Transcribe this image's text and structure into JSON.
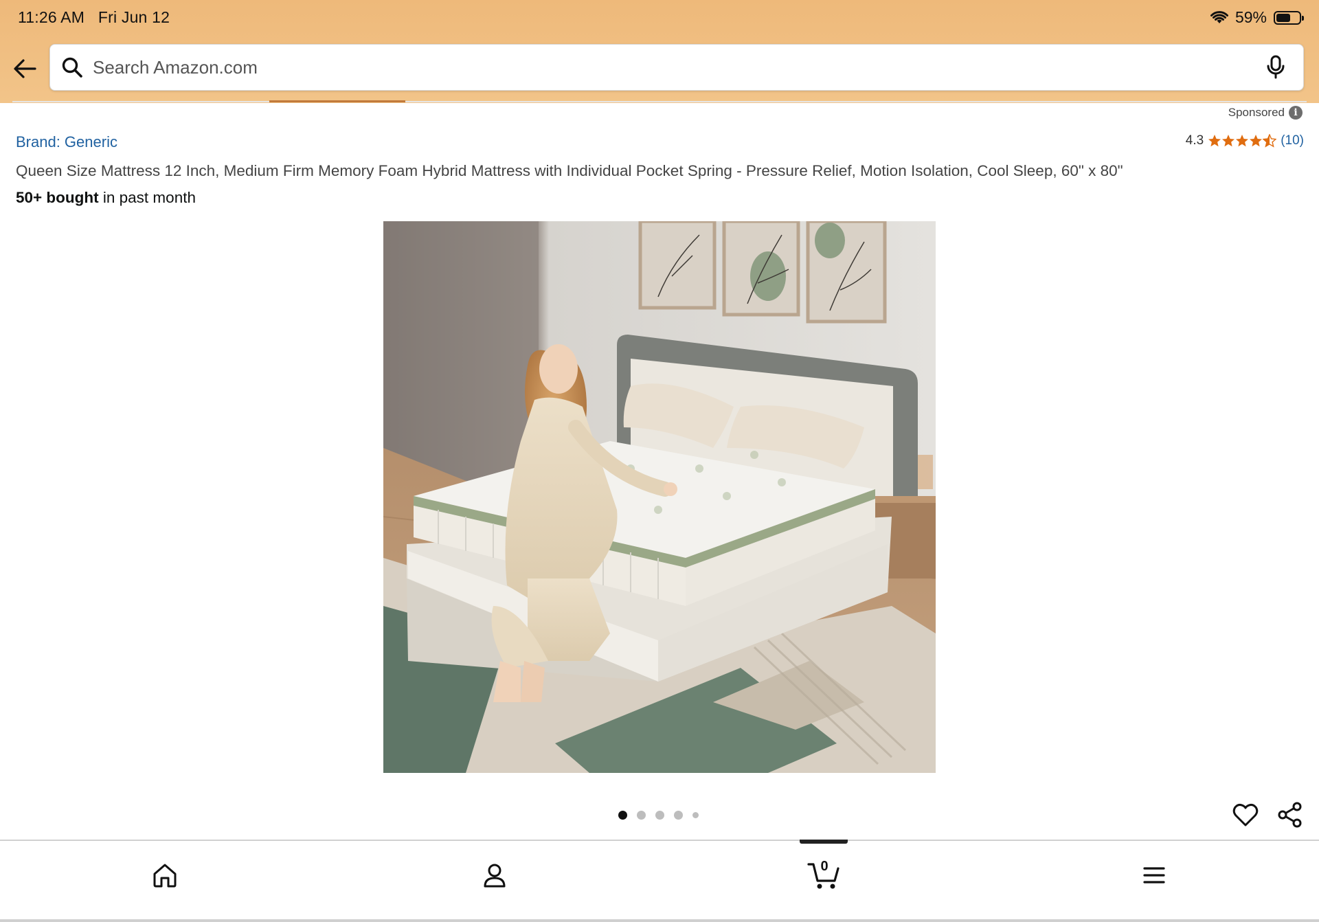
{
  "status_bar": {
    "time": "11:26 AM",
    "date": "Fri Jun 12",
    "battery": "59%"
  },
  "search": {
    "placeholder": "Search Amazon.com"
  },
  "sponsored": {
    "label": "Sponsored"
  },
  "product": {
    "brand": "Brand: Generic",
    "rating_value": "4.3",
    "rating_stars": 4.5,
    "rating_count": "(10)",
    "title": "Queen Size Mattress 12 Inch, Medium Firm Memory Foam Hybrid Mattress with Individual Pocket Spring - Pressure Relief, Motion Isolation, Cool Sleep, 60\" x 80\"",
    "bought_strong": "50+ bought",
    "bought_rest": " in past month"
  },
  "carousel": {
    "total": 5,
    "active": 1
  },
  "cart": {
    "count": "0"
  },
  "colors": {
    "header": "#f0bd7f",
    "link": "#2162a1",
    "star": "#e06d10"
  }
}
